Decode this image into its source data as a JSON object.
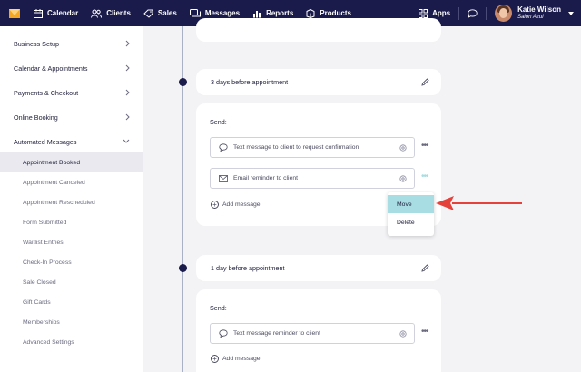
{
  "nav": {
    "items": [
      {
        "label": "Calendar",
        "icon": "calendar-icon"
      },
      {
        "label": "Clients",
        "icon": "clients-icon"
      },
      {
        "label": "Sales",
        "icon": "tag-icon"
      },
      {
        "label": "Messages",
        "icon": "messages-icon"
      },
      {
        "label": "Reports",
        "icon": "bar-chart-icon"
      },
      {
        "label": "Products",
        "icon": "box-icon"
      }
    ],
    "apps_label": "Apps",
    "user_name": "Katie Wilson",
    "user_salon": "Salon Azul"
  },
  "sidebar": {
    "sections": [
      "Business Setup",
      "Calendar & Appointments",
      "Payments & Checkout",
      "Online Booking",
      "Automated Messages"
    ],
    "subitems": [
      "Appointment Booked",
      "Appointment Canceled",
      "Appointment Rescheduled",
      "Form Submitted",
      "Waitlist Entries",
      "Check-In Process",
      "Sale Closed",
      "Gift Cards",
      "Memberships",
      "Advanced Settings"
    ]
  },
  "main": {
    "section1": {
      "title": "3 days before appointment",
      "send_label": "Send:",
      "messages": [
        "Text message to client to request confirmation",
        "Email reminder to client"
      ],
      "add_label": "Add message"
    },
    "section2": {
      "title": "1 day before appointment",
      "send_label": "Send:",
      "messages": [
        "Text message reminder to client"
      ],
      "add_label": "Add message"
    },
    "dropdown": {
      "move": "Move",
      "delete": "Delete"
    }
  },
  "colors": {
    "nav_bg": "#1a1b4b",
    "highlight": "#a8dde3",
    "arrow": "#e5413b"
  }
}
